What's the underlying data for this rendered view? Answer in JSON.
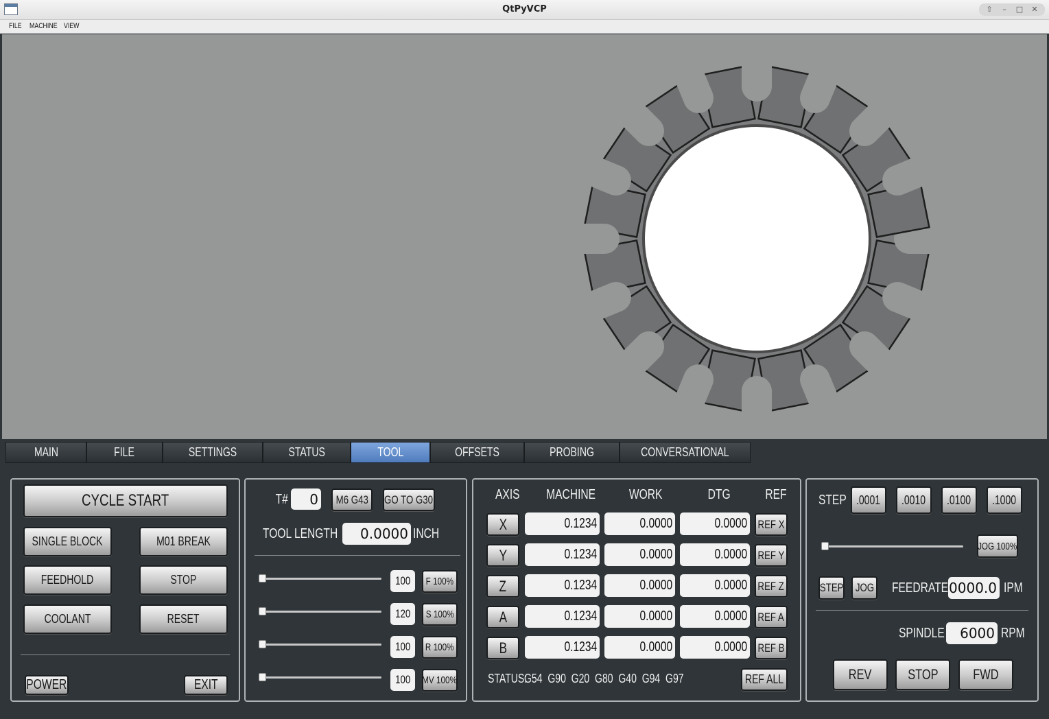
{
  "window": {
    "title": "QtPyVCP"
  },
  "menu": [
    "FILE",
    "MACHINE",
    "VIEW"
  ],
  "tabs": [
    {
      "label": "MAIN",
      "w": 118
    },
    {
      "label": "FILE",
      "w": 111
    },
    {
      "label": "SETTINGS",
      "w": 146
    },
    {
      "label": "STATUS",
      "w": 128
    },
    {
      "label": "TOOL",
      "w": 116,
      "active": true
    },
    {
      "label": "OFFSETS",
      "w": 137
    },
    {
      "label": "PROBING",
      "w": 139
    },
    {
      "label": "CONVERSATIONAL",
      "w": 191
    }
  ],
  "controls": {
    "cycle_start": "CYCLE START",
    "single_block": "SINGLE BLOCK",
    "m01_break": "M01 BREAK",
    "feedhold": "FEEDHOLD",
    "stop": "STOP",
    "coolant": "COOLANT",
    "reset": "RESET",
    "power": "POWER",
    "exit": "EXIT"
  },
  "tool": {
    "tnum_label": "T#",
    "tnum_value": "0",
    "m6g43": "M6 G43",
    "goto_g30": "GO TO G30",
    "length_label": "TOOL LENGTH",
    "length_value": "0.0000",
    "length_unit": "INCH",
    "overrides": [
      {
        "value": "100",
        "button": "F 100%",
        "level": 0
      },
      {
        "value": "120",
        "button": "S 100%",
        "level": 0
      },
      {
        "value": "100",
        "button": "R 100%",
        "level": 0
      },
      {
        "value": "100",
        "button": "MV 100%",
        "level": 0
      }
    ]
  },
  "dro": {
    "headers": {
      "axis": "AXIS",
      "machine": "MACHINE",
      "work": "WORK",
      "dtg": "DTG",
      "ref": "REF"
    },
    "rows": [
      {
        "axis": "X",
        "machine": "0.1234",
        "work": "0.0000",
        "dtg": "0.0000",
        "ref": "REF X"
      },
      {
        "axis": "Y",
        "machine": "0.1234",
        "work": "0.0000",
        "dtg": "0.0000",
        "ref": "REF Y"
      },
      {
        "axis": "Z",
        "machine": "0.1234",
        "work": "0.0000",
        "dtg": "0.0000",
        "ref": "REF Z"
      },
      {
        "axis": "A",
        "machine": "0.1234",
        "work": "0.0000",
        "dtg": "0.0000",
        "ref": "REF A"
      },
      {
        "axis": "B",
        "machine": "0.1234",
        "work": "0.0000",
        "dtg": "0.0000",
        "ref": "REF B"
      }
    ],
    "status_label": "STATUS:",
    "status_codes": "G54  G90  G20  G80  G40  G94  G97",
    "ref_all": "REF ALL"
  },
  "jog": {
    "step_label": "STEP",
    "steps": [
      ".0001",
      ".0010",
      ".0100",
      ".1000"
    ],
    "jog_button": "JOG 100%",
    "jog_level": 0,
    "step_mode": "STEP",
    "jog_mode": "JOG",
    "feedrate_label": "FEEDRATE",
    "feedrate_value": "0000.0",
    "feedrate_unit": "IPM",
    "spindle_label": "SPINDLE",
    "spindle_value": "6000",
    "spindle_unit": "RPM",
    "rev": "REV",
    "stop": "STOP",
    "fwd": "FWD"
  },
  "colors": {
    "background": "#2f3538",
    "viewport": "#969897",
    "tab_active": "#5f8ccc"
  }
}
